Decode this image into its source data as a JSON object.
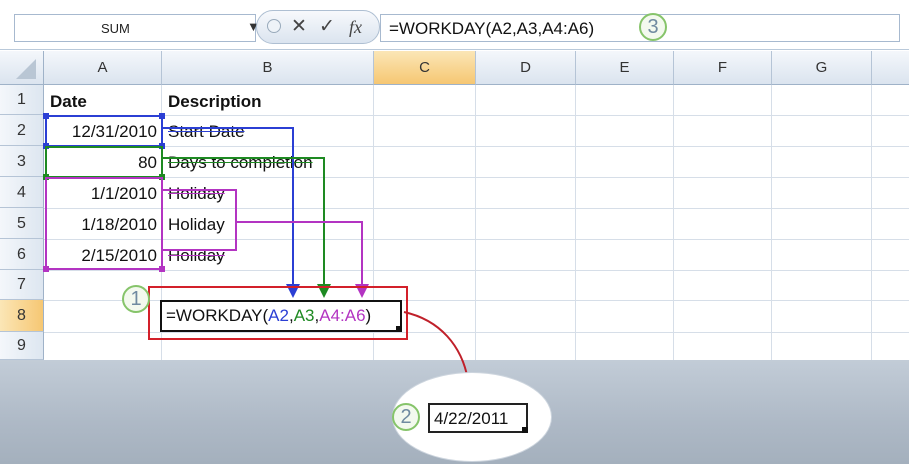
{
  "formula_bar": {
    "name_box": "SUM",
    "dropdown_icon": "caret-down-icon",
    "cancel_glyph": "✕",
    "enter_glyph": "✓",
    "fx_label": "fx",
    "formula": "=WORKDAY(A2,A3,A4:A6)",
    "callout": "3"
  },
  "columns": [
    "A",
    "B",
    "C",
    "D",
    "E",
    "F",
    "G"
  ],
  "selected_column": "C",
  "rows": [
    "1",
    "2",
    "3",
    "4",
    "5",
    "6",
    "7",
    "8",
    "9"
  ],
  "selected_row": "8",
  "cells": {
    "a1": "Date",
    "b1": "Description",
    "a2": "12/31/2010",
    "b2": "Start Date",
    "a3": "80",
    "b3": "Days to completion",
    "a4": "1/1/2010",
    "b4": "Holiday",
    "a5": "1/18/2010",
    "b5": "Holiday",
    "a6": "2/15/2010",
    "b6": "Holiday"
  },
  "cell_formula": {
    "prefix": "=WORKDAY(",
    "arg1": "A2",
    "sep1": ",",
    "arg2": "A3",
    "sep2": ",",
    "arg3": "A4:A6",
    "suffix": ")",
    "callout": "1"
  },
  "result": {
    "value": "4/22/2011",
    "callout": "2"
  },
  "colors": {
    "arg1": "#2b3fd4",
    "arg2": "#1e8a22",
    "arg3": "#b334c2",
    "callout_frame": "#d3202a",
    "callout_ring": "#86c46a"
  }
}
